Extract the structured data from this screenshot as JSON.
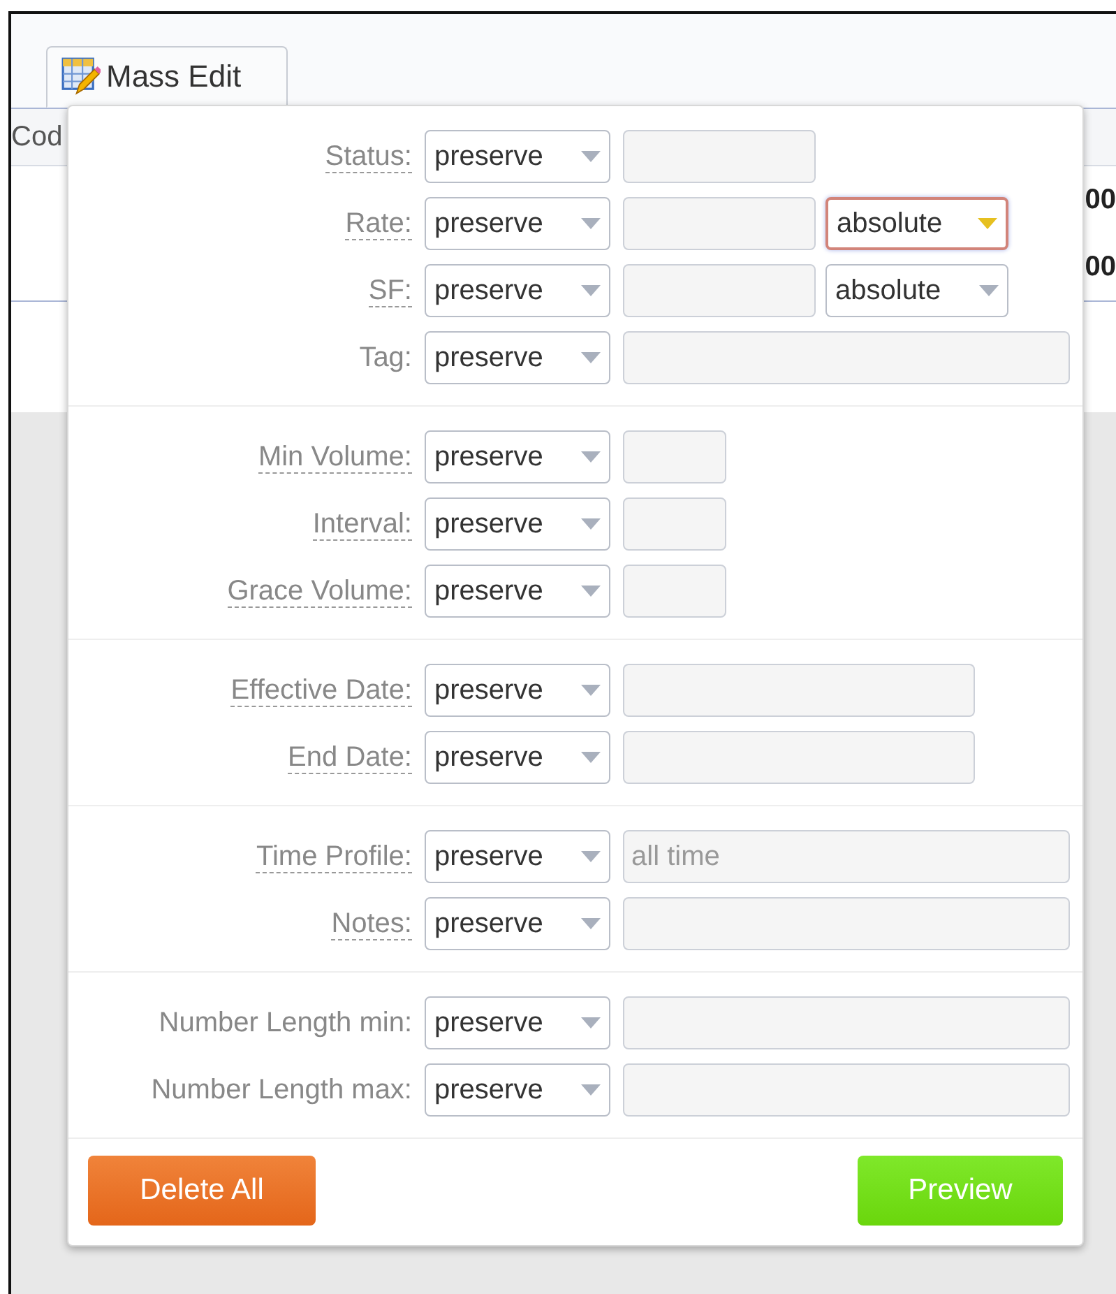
{
  "toolbar": {
    "mass_edit_button": {
      "label": "Mass Edit",
      "selected": true
    }
  },
  "table": {
    "columns": [
      {
        "label": "Cod"
      }
    ],
    "rows": [
      {
        "column_2": "00"
      },
      {
        "column_2": "00"
      }
    ]
  },
  "mass_edit": {
    "groups": [
      {
        "fields": [
          {
            "label": "Status:",
            "has_tooltip": true,
            "mode": "preserve",
            "input": {
              "kind": "medium"
            }
          },
          {
            "label": "Rate:",
            "has_tooltip": true,
            "mode": "preserve",
            "input": {
              "kind": "medium"
            },
            "unit": {
              "value": "absolute",
              "focused": true
            }
          },
          {
            "label": "SF:",
            "has_tooltip": true,
            "mode": "preserve",
            "input": {
              "kind": "medium"
            },
            "unit": {
              "value": "absolute",
              "focused": false
            }
          },
          {
            "label": "Tag:",
            "has_tooltip": false,
            "mode": "preserve",
            "input": {
              "kind": "full"
            }
          }
        ]
      },
      {
        "fields": [
          {
            "label": "Min Volume:",
            "has_tooltip": true,
            "mode": "preserve",
            "input": {
              "kind": "short"
            }
          },
          {
            "label": "Interval:",
            "has_tooltip": true,
            "mode": "preserve",
            "input": {
              "kind": "short"
            }
          },
          {
            "label": "Grace Volume:",
            "has_tooltip": true,
            "mode": "preserve",
            "input": {
              "kind": "short"
            }
          }
        ]
      },
      {
        "fields": [
          {
            "label": "Effective Date:",
            "has_tooltip": true,
            "mode": "preserve",
            "input": {
              "kind": "long"
            }
          },
          {
            "label": "End Date:",
            "has_tooltip": true,
            "mode": "preserve",
            "input": {
              "kind": "long"
            }
          }
        ]
      },
      {
        "fields": [
          {
            "label": "Time Profile:",
            "has_tooltip": true,
            "mode": "preserve",
            "input": {
              "kind": "full",
              "placeholder": "all time"
            }
          },
          {
            "label": "Notes:",
            "has_tooltip": true,
            "mode": "preserve",
            "input": {
              "kind": "full"
            }
          }
        ]
      },
      {
        "fields": [
          {
            "label": "Number Length min:",
            "has_tooltip": false,
            "mode": "preserve",
            "input": {
              "kind": "full"
            }
          },
          {
            "label": "Number Length max:",
            "has_tooltip": false,
            "mode": "preserve",
            "input": {
              "kind": "full"
            }
          }
        ]
      }
    ],
    "buttons": [
      {
        "label": "Delete All",
        "kind": "danger"
      },
      {
        "label": "Preview",
        "kind": "primary"
      }
    ]
  }
}
